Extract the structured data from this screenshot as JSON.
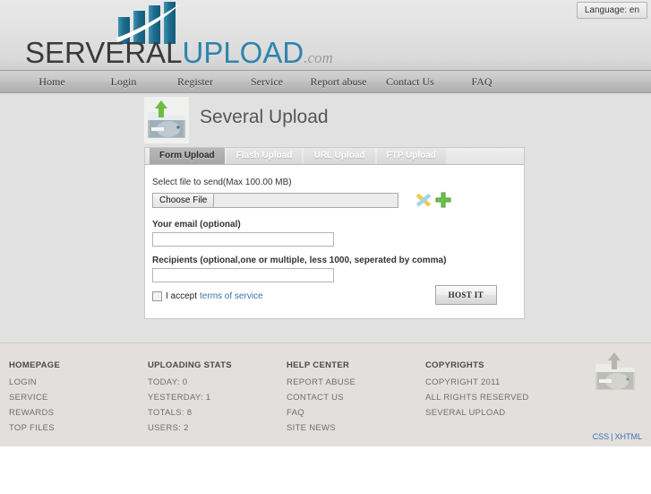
{
  "header": {
    "language_button": "Language: en",
    "logo": {
      "part1": "SERVERAL",
      "part2": "UPLOAD",
      "part3": ".com",
      "icon": "bar-chart-swoosh-logo",
      "bar_color": "#2a7fa3",
      "word_color": "#3a3a3a",
      "upload_color": "#2f84ad"
    }
  },
  "nav": {
    "items": [
      {
        "label": "Home"
      },
      {
        "label": "Login"
      },
      {
        "label": "Register"
      },
      {
        "label": "Service"
      },
      {
        "label": "Report abuse"
      },
      {
        "label": "Contact Us"
      },
      {
        "label": "FAQ"
      }
    ]
  },
  "main": {
    "page_title": "Several Upload",
    "title_icon": "folder-upload-icon",
    "tabs": [
      {
        "label": "Form Upload",
        "active": true
      },
      {
        "label": "Flash Upload",
        "active": false
      },
      {
        "label": "URL Upload",
        "active": false
      },
      {
        "label": "FTP Upload",
        "active": false
      }
    ],
    "form": {
      "file_label": "Select file to send(Max 100.00 MB)",
      "choose_file_button": "Choose File",
      "file_name_value": "",
      "add_icon": "green-plus-icon",
      "edit_icon": "pencil-cross-icon",
      "email_label": "Your email (optional)",
      "email_value": "",
      "email_placeholder": "",
      "recipients_label": "Recipients (optional,one or multiple, less 1000, seperated by comma)",
      "recipients_value": "",
      "recipients_placeholder": "",
      "accept_text": "I accept",
      "terms_link": "terms of service",
      "accept_checked": false,
      "submit_button": "HOST IT"
    }
  },
  "footer": {
    "columns": [
      {
        "heading": "HOMEPAGE",
        "items": [
          "LOGIN",
          "SERVICE",
          "REWARDS",
          "TOP FILES"
        ]
      },
      {
        "heading": "UPLOADING STATS",
        "items": [
          "TODAY: 0",
          "YESTERDAY: 1",
          "TOTALS: 8",
          "USERS: 2"
        ]
      },
      {
        "heading": "HELP CENTER",
        "items": [
          "REPORT ABUSE",
          "CONTACT US",
          "FAQ",
          "SITE NEWS"
        ]
      },
      {
        "heading": "COPYRIGHTS",
        "items": [
          "COPYRIGHT 2011",
          "ALL RIGHTS RESERVED",
          "SEVERAL UPLOAD"
        ]
      }
    ],
    "logo_icon": "folder-upload-icon",
    "validation": {
      "css_link": "CSS",
      "separator": "|",
      "xhtml_link": "XHTML",
      "link_color": "#3a72b0"
    }
  }
}
